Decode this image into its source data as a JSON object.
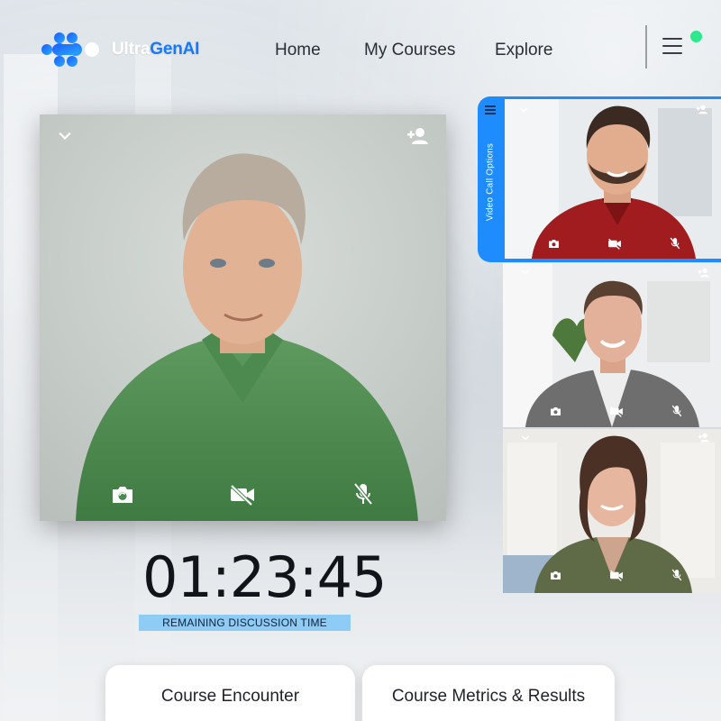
{
  "brand": {
    "name_part1": "Ultra",
    "name_part2": "GenAI",
    "accent_color": "#1677ff"
  },
  "nav": {
    "items": [
      "Home",
      "My Courses",
      "Explore"
    ]
  },
  "header": {
    "menu_icon": "hamburger-menu-icon",
    "status_color": "#2ee88e"
  },
  "main_video": {
    "top_left_icon": "chevron-down-icon",
    "top_right_icon": "add-person-icon",
    "controls": [
      "switch-camera-icon",
      "video-off-icon",
      "mic-off-icon"
    ]
  },
  "side_panel": {
    "tab_label": "Video Call Options",
    "tab_color": "#1e8cff",
    "participants": [
      {
        "icons": [
          "chevron-down-icon",
          "add-person-icon",
          "camera-icon",
          "video-off-icon",
          "mic-off-icon"
        ]
      },
      {
        "icons": [
          "chevron-down-icon",
          "add-person-icon",
          "camera-icon",
          "video-off-icon",
          "mic-off-icon"
        ]
      },
      {
        "icons": [
          "chevron-down-icon",
          "add-person-icon",
          "camera-icon",
          "video-off-icon",
          "mic-off-icon"
        ]
      }
    ]
  },
  "timer": {
    "value": "01:23:45",
    "label": "REMAINING DISCUSSION TIME"
  },
  "cards": [
    {
      "label": "Course Encounter"
    },
    {
      "label": "Course Metrics & Results"
    }
  ]
}
